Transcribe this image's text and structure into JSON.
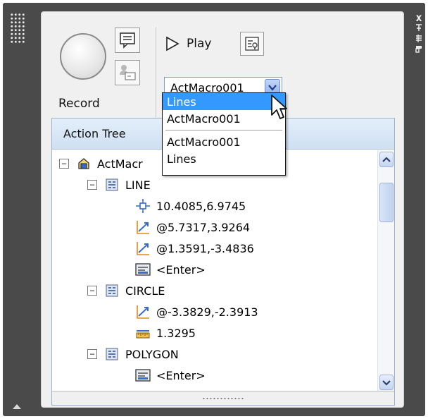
{
  "window": {
    "close_symbol": "x",
    "title_bar_icons": [
      "close-icon",
      "auto-hide-icon",
      "properties-icon",
      "window-options-icon"
    ]
  },
  "toolbar": {
    "record_label": "Record",
    "play_label": "Play"
  },
  "macro_combo": {
    "selected_value": "ActMacro001"
  },
  "dropdown": {
    "items": [
      "Lines",
      "ActMacro001"
    ],
    "recent_items": [
      "ActMacro001",
      "Lines"
    ],
    "highlighted": "Lines"
  },
  "tree": {
    "header": "Action Tree",
    "root_label": "ActMacr",
    "rows": [
      {
        "label": "LINE",
        "icon": "command-icon"
      },
      {
        "label": "10.4085,6.9745",
        "icon": "point-icon"
      },
      {
        "label": "@5.7317,3.9264",
        "icon": "relative-point-icon"
      },
      {
        "label": "@1.3591,-3.4836",
        "icon": "relative-point-icon"
      },
      {
        "label": "<Enter>",
        "icon": "enter-icon"
      },
      {
        "label": "CIRCLE",
        "icon": "command-icon"
      },
      {
        "label": "@-3.3829,-2.3913",
        "icon": "relative-point-icon"
      },
      {
        "label": "1.3295",
        "icon": "distance-icon"
      },
      {
        "label": "POLYGON",
        "icon": "command-icon"
      },
      {
        "label": "<Enter>",
        "icon": "enter-icon"
      }
    ]
  },
  "colors": {
    "selection": "#3399ff",
    "frame": "#4a4a4a",
    "panel": "#f0f0f0"
  }
}
